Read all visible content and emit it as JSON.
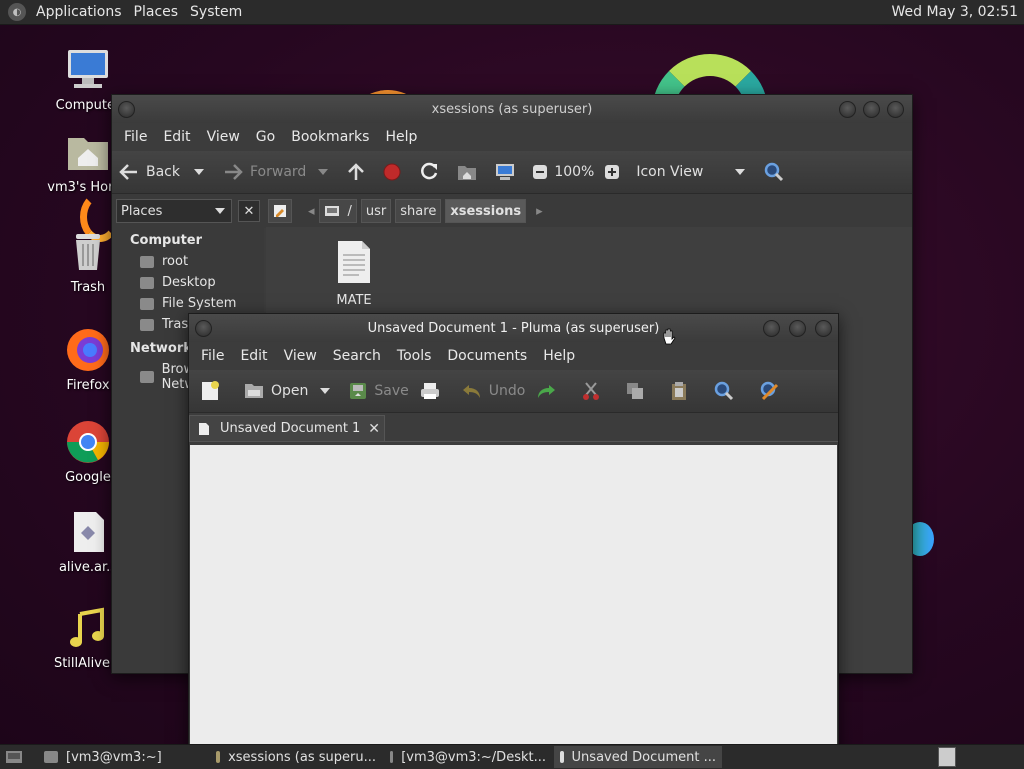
{
  "top_panel": {
    "menus": [
      "Applications",
      "Places",
      "System"
    ],
    "clock": "Wed May  3, 02:51"
  },
  "desktop": {
    "icons": [
      {
        "label": "Computer",
        "icon": "computer-icon"
      },
      {
        "label": "vm3's Home",
        "icon": "home-folder-icon"
      },
      {
        "label": "Trash",
        "icon": "trash-icon"
      },
      {
        "label": "Firefox",
        "icon": "firefox-icon"
      },
      {
        "label": "Google",
        "icon": "chrome-icon"
      },
      {
        "label": "alive.ar.s",
        "icon": "file-icon"
      },
      {
        "label": "StillAlive.o",
        "icon": "music-file-icon"
      }
    ]
  },
  "caja": {
    "title": "xsessions (as superuser)",
    "menu": [
      "File",
      "Edit",
      "View",
      "Go",
      "Bookmarks",
      "Help"
    ],
    "toolbar": {
      "back": "Back",
      "forward": "Forward",
      "zoom": "100%",
      "view_mode": "Icon View"
    },
    "places_label": "Places",
    "breadcrumbs": [
      "/",
      "usr",
      "share",
      "xsessions"
    ],
    "sidebar": {
      "computer_head": "Computer",
      "computer_items": [
        "root",
        "Desktop",
        "File System",
        "Trash"
      ],
      "network_head": "Network",
      "network_items": [
        "Browse Network"
      ]
    },
    "files": [
      {
        "name": "MATE"
      }
    ]
  },
  "pluma": {
    "title": "Unsaved Document 1 - Pluma (as superuser)",
    "menu": [
      "File",
      "Edit",
      "View",
      "Search",
      "Tools",
      "Documents",
      "Help"
    ],
    "toolbar": {
      "open": "Open",
      "save": "Save",
      "undo": "Undo"
    },
    "tab_label": "Unsaved Document 1"
  },
  "taskbar": {
    "tasks": [
      {
        "label": "[vm3@vm3:~]",
        "active": false
      },
      {
        "label": "xsessions (as superu...",
        "active": false
      },
      {
        "label": "[vm3@vm3:~/Deskt...",
        "active": false
      },
      {
        "label": "Unsaved Document ...",
        "active": true
      }
    ]
  }
}
